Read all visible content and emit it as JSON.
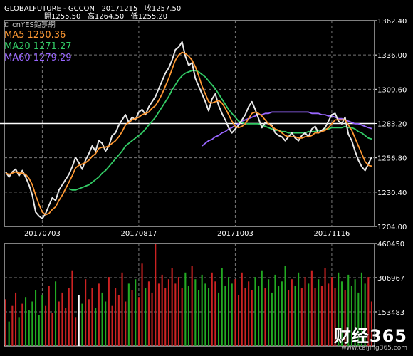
{
  "header": {
    "row1": "GLOBALFUTURE - GCCON   20171215   收1257.50",
    "row2": "開1255.50   高1264.50   低1255.20"
  },
  "watermark": "© cnYES鉅亨網",
  "ma_labels": [
    {
      "text": "MA5 1250.36",
      "color": "#ff9933"
    },
    {
      "text": "MA20 1271.27",
      "color": "#33cc66"
    },
    {
      "text": "MA60 1279.29",
      "color": "#9966ff"
    }
  ],
  "brand": {
    "name": "财经365",
    "url": "www.caijing365.com"
  },
  "colors": {
    "grid": "#777777",
    "axis": "#ffffff",
    "price": "#e8e8e8",
    "ma5": "#ff9933",
    "ma20": "#33cc66",
    "ma60": "#9966ff",
    "vol_up": "#cc2222",
    "vol_down": "#22aa22",
    "ref_line": "#ffffff"
  },
  "chart_data": [
    {
      "type": "line",
      "title": "GLOBALFUTURE - GCCON",
      "x_ticks": [
        "20170703",
        "20170817",
        "20171003",
        "20171116"
      ],
      "y_ticks": [
        1362.4,
        1336.0,
        1309.6,
        1283.2,
        1256.8,
        1230.4,
        1204.0
      ],
      "ylim": [
        1204.0,
        1362.4
      ],
      "reference_line": 1283.2,
      "series": [
        {
          "name": "price",
          "values": [
            1246,
            1242,
            1246,
            1248,
            1243,
            1247,
            1242,
            1236,
            1228,
            1215,
            1212,
            1210,
            1214,
            1220,
            1226,
            1224,
            1232,
            1236,
            1240,
            1244,
            1250,
            1257,
            1253,
            1248,
            1255,
            1260,
            1266,
            1262,
            1270,
            1268,
            1262,
            1266,
            1274,
            1276,
            1282,
            1286,
            1290,
            1284,
            1288,
            1286,
            1292,
            1294,
            1290,
            1296,
            1300,
            1304,
            1310,
            1316,
            1322,
            1326,
            1332,
            1340,
            1342,
            1346,
            1335,
            1328,
            1330,
            1318,
            1312,
            1306,
            1300,
            1293,
            1302,
            1306,
            1297,
            1291,
            1286,
            1280,
            1276,
            1279,
            1282,
            1286,
            1290,
            1296,
            1300,
            1294,
            1287,
            1280,
            1284,
            1283,
            1282,
            1276,
            1274,
            1273,
            1270,
            1273,
            1276,
            1272,
            1270,
            1274,
            1276,
            1273,
            1279,
            1281,
            1276,
            1278,
            1280,
            1285,
            1290,
            1291,
            1285,
            1283,
            1288,
            1275,
            1270,
            1262,
            1255,
            1250,
            1247,
            1252,
            1257.5
          ]
        },
        {
          "name": "MA5",
          "values": [
            1245,
            1244,
            1245,
            1246,
            1245,
            1245,
            1244,
            1241,
            1236,
            1228,
            1221,
            1215,
            1213,
            1214,
            1217,
            1219,
            1224,
            1228,
            1233,
            1238,
            1243,
            1249,
            1251,
            1252,
            1253,
            1255,
            1258,
            1260,
            1264,
            1265,
            1265,
            1266,
            1268,
            1270,
            1273,
            1277,
            1282,
            1284,
            1286,
            1287,
            1288,
            1290,
            1291,
            1292,
            1295,
            1297,
            1301,
            1306,
            1312,
            1318,
            1325,
            1332,
            1336,
            1338,
            1337,
            1335,
            1332,
            1327,
            1320,
            1312,
            1306,
            1300,
            1299,
            1300,
            1301,
            1299,
            1295,
            1290,
            1285,
            1281,
            1280,
            1281,
            1283,
            1287,
            1291,
            1292,
            1291,
            1289,
            1286,
            1283,
            1281,
            1279,
            1278,
            1276,
            1274,
            1273,
            1273,
            1273,
            1272,
            1272,
            1273,
            1273,
            1274,
            1276,
            1276,
            1277,
            1278,
            1280,
            1283,
            1286,
            1286,
            1286,
            1286,
            1282,
            1278,
            1272,
            1266,
            1260,
            1254,
            1251,
            1250.36
          ]
        },
        {
          "name": "MA20",
          "values": [
            null,
            null,
            null,
            null,
            null,
            null,
            null,
            null,
            null,
            null,
            null,
            null,
            null,
            null,
            null,
            null,
            null,
            null,
            null,
            1233,
            1232,
            1232,
            1233,
            1234,
            1235,
            1236,
            1238,
            1240,
            1242,
            1245,
            1247,
            1250,
            1253,
            1256,
            1259,
            1262,
            1266,
            1268,
            1270,
            1272,
            1274,
            1276,
            1279,
            1282,
            1285,
            1288,
            1292,
            1296,
            1300,
            1304,
            1309,
            1313,
            1317,
            1320,
            1322,
            1323,
            1324,
            1324,
            1323,
            1321,
            1319,
            1316,
            1313,
            1310,
            1306,
            1302,
            1298,
            1294,
            1291,
            1288,
            1285,
            1284,
            1283,
            1283,
            1283,
            1283,
            1283,
            1282,
            1281,
            1280,
            1279,
            1278,
            1278,
            1277,
            1277,
            1276,
            1276,
            1276,
            1276,
            1276,
            1276,
            1277,
            1277,
            1277,
            1278,
            1278,
            1279,
            1279,
            1280,
            1280,
            1280,
            1280,
            1281,
            1280,
            1280,
            1279,
            1277,
            1276,
            1274,
            1272,
            1271.27
          ]
        },
        {
          "name": "MA60",
          "values": [
            null,
            null,
            null,
            null,
            null,
            null,
            null,
            null,
            null,
            null,
            null,
            null,
            null,
            null,
            null,
            null,
            null,
            null,
            null,
            null,
            null,
            null,
            null,
            null,
            null,
            null,
            null,
            null,
            null,
            null,
            null,
            null,
            null,
            null,
            null,
            null,
            null,
            null,
            null,
            null,
            null,
            null,
            null,
            null,
            null,
            null,
            null,
            null,
            null,
            null,
            null,
            null,
            null,
            null,
            null,
            null,
            null,
            null,
            null,
            1266,
            1268,
            1270,
            1271,
            1273,
            1274,
            1276,
            1277,
            1279,
            1280,
            1282,
            1283,
            1285,
            1286,
            1287,
            1288,
            1289,
            1290,
            1290,
            1291,
            1291,
            1292,
            1292,
            1292,
            1292,
            1292,
            1292,
            1292,
            1292,
            1292,
            1292,
            1292,
            1292,
            1291,
            1291,
            1291,
            1290,
            1290,
            1289,
            1289,
            1288,
            1287,
            1287,
            1286,
            1285,
            1284,
            1283,
            1283,
            1282,
            1281,
            1280,
            1279.29
          ]
        }
      ]
    },
    {
      "type": "bar",
      "title": "Volume",
      "y_ticks": [
        460450,
        306967,
        153483
      ],
      "ylim": [
        0,
        460450
      ],
      "series": [
        {
          "name": "volume",
          "values": [
            210000,
            110000,
            180000,
            240000,
            130000,
            190000,
            220000,
            160000,
            200000,
            250000,
            140000,
            230000,
            180000,
            270000,
            150000,
            290000,
            200000,
            240000,
            170000,
            260000,
            340000,
            130000,
            230000,
            190000,
            300000,
            210000,
            260000,
            170000,
            280000,
            240000,
            200000,
            310000,
            180000,
            260000,
            230000,
            330000,
            200000,
            280000,
            250000,
            300000,
            220000,
            370000,
            260000,
            290000,
            240000,
            460000,
            280000,
            320000,
            260000,
            300000,
            350000,
            280000,
            310000,
            260000,
            330000,
            270000,
            360000,
            300000,
            250000,
            320000,
            280000,
            260000,
            330000,
            290000,
            240000,
            350000,
            270000,
            310000,
            280000,
            300000,
            230000,
            330000,
            260000,
            290000,
            250000,
            310000,
            270000,
            340000,
            260000,
            300000,
            240000,
            320000,
            270000,
            290000,
            360000,
            250000,
            300000,
            270000,
            330000,
            260000,
            310000,
            280000,
            340000,
            260000,
            300000,
            270000,
            350000,
            280000,
            310000,
            260000,
            330000,
            290000,
            250000,
            320000,
            270000,
            300000,
            240000,
            330000,
            280000,
            310000,
            200000
          ]
        },
        {
          "name": "direction",
          "values": [
            1,
            0,
            1,
            1,
            0,
            1,
            0,
            0,
            0,
            0,
            0,
            0,
            1,
            1,
            1,
            0,
            1,
            1,
            1,
            1,
            1,
            1,
            0,
            0,
            1,
            1,
            1,
            0,
            1,
            0,
            0,
            1,
            1,
            1,
            1,
            1,
            1,
            0,
            1,
            0,
            1,
            1,
            0,
            1,
            1,
            1,
            1,
            1,
            1,
            1,
            1,
            1,
            1,
            1,
            0,
            0,
            1,
            0,
            0,
            0,
            0,
            0,
            1,
            1,
            0,
            0,
            0,
            0,
            0,
            1,
            1,
            1,
            1,
            1,
            1,
            0,
            0,
            0,
            1,
            0,
            0,
            0,
            0,
            0,
            0,
            1,
            1,
            0,
            0,
            1,
            1,
            0,
            1,
            1,
            0,
            1,
            1,
            1,
            1,
            1,
            0,
            0,
            1,
            0,
            0,
            0,
            0,
            0,
            0,
            1,
            1
          ]
        }
      ]
    }
  ]
}
